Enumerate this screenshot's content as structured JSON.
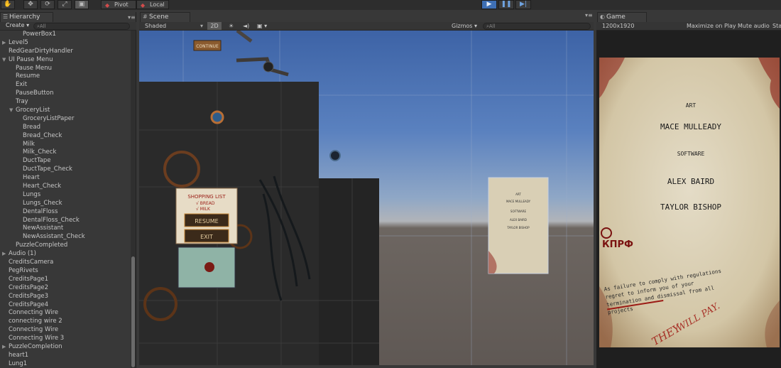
{
  "toolbar": {
    "tools": [
      "hand-tool",
      "move-tool",
      "rotate-tool",
      "scale-tool",
      "rect-tool"
    ],
    "pivot_label": "Pivot",
    "space_label": "Local"
  },
  "hierarchy": {
    "tab_label": "Hierarchy",
    "create_label": "Create",
    "search_placeholder": "All",
    "items": [
      {
        "label": "PowerBox1",
        "depth": 2,
        "arrow": ""
      },
      {
        "label": "Level5",
        "depth": 0,
        "arrow": "▶"
      },
      {
        "label": "RedGearDirtyHandler",
        "depth": 0,
        "arrow": ""
      },
      {
        "label": "UI Pause Menu",
        "depth": 0,
        "arrow": "▼"
      },
      {
        "label": "Pause Menu",
        "depth": 1,
        "arrow": ""
      },
      {
        "label": "Resume",
        "depth": 1,
        "arrow": ""
      },
      {
        "label": "Exit",
        "depth": 1,
        "arrow": ""
      },
      {
        "label": "PauseButton",
        "depth": 1,
        "arrow": ""
      },
      {
        "label": "Tray",
        "depth": 1,
        "arrow": ""
      },
      {
        "label": "GroceryList",
        "depth": 1,
        "arrow": "▼"
      },
      {
        "label": "GroceryListPaper",
        "depth": 2,
        "arrow": ""
      },
      {
        "label": "Bread",
        "depth": 2,
        "arrow": ""
      },
      {
        "label": "Bread_Check",
        "depth": 2,
        "arrow": ""
      },
      {
        "label": "Milk",
        "depth": 2,
        "arrow": ""
      },
      {
        "label": "Milk_Check",
        "depth": 2,
        "arrow": ""
      },
      {
        "label": "DuctTape",
        "depth": 2,
        "arrow": ""
      },
      {
        "label": "DuctTape_Check",
        "depth": 2,
        "arrow": ""
      },
      {
        "label": "Heart",
        "depth": 2,
        "arrow": ""
      },
      {
        "label": "Heart_Check",
        "depth": 2,
        "arrow": ""
      },
      {
        "label": "Lungs",
        "depth": 2,
        "arrow": ""
      },
      {
        "label": "Lungs_Check",
        "depth": 2,
        "arrow": ""
      },
      {
        "label": "DentalFloss",
        "depth": 2,
        "arrow": ""
      },
      {
        "label": "DentalFloss_Check",
        "depth": 2,
        "arrow": ""
      },
      {
        "label": "NewAssistant",
        "depth": 2,
        "arrow": ""
      },
      {
        "label": "NewAssistant_Check",
        "depth": 2,
        "arrow": ""
      },
      {
        "label": "PuzzleCompleted",
        "depth": 1,
        "arrow": ""
      },
      {
        "label": "Audio (1)",
        "depth": 0,
        "arrow": "▶"
      },
      {
        "label": "CreditsCamera",
        "depth": 0,
        "arrow": ""
      },
      {
        "label": "PegRivets",
        "depth": 0,
        "arrow": ""
      },
      {
        "label": "CreditsPage1",
        "depth": 0,
        "arrow": ""
      },
      {
        "label": "CreditsPage2",
        "depth": 0,
        "arrow": ""
      },
      {
        "label": "CreditsPage3",
        "depth": 0,
        "arrow": ""
      },
      {
        "label": "CreditsPage4",
        "depth": 0,
        "arrow": ""
      },
      {
        "label": "Connecting Wire",
        "depth": 0,
        "arrow": ""
      },
      {
        "label": "connecting wire 2",
        "depth": 0,
        "arrow": ""
      },
      {
        "label": "Connecting Wire",
        "depth": 0,
        "arrow": ""
      },
      {
        "label": "Connecting Wire 3",
        "depth": 0,
        "arrow": ""
      },
      {
        "label": "PuzzleCompletion",
        "depth": 0,
        "arrow": "▶"
      },
      {
        "label": "heart1",
        "depth": 0,
        "arrow": ""
      },
      {
        "label": "Lung1",
        "depth": 0,
        "arrow": ""
      }
    ]
  },
  "scene": {
    "tab_label": "Scene",
    "shading_mode": "Shaded",
    "mode_2d": "2D",
    "gizmos_label": "Gizmos",
    "search_placeholder": "All",
    "continue_sign": "CONTINUE",
    "shopping_title": "SHOPPING LIST",
    "shopping_line1": "√ BREAD",
    "shopping_line2": "√ MILK",
    "resume_label": "RESUME",
    "exit_label": "EXIT",
    "mini_credits": [
      "ART",
      "MACE MULLEADY",
      "SOFTWARE",
      "ALEX BAIRD",
      "TAYLOR BISHOP"
    ]
  },
  "game": {
    "tab_label": "Game",
    "resolution": "1200x1920",
    "maximize_label": "Maximize on Play",
    "mute_label": "Mute audio",
    "stats_label": "Sta",
    "credit_art_heading": "ART",
    "credit_art_name": "MACE MULLEADY",
    "credit_software_heading": "SOFTWARE",
    "credit_software_name1": "ALEX BAIRD",
    "credit_software_name2": "TAYLOR BISHOP",
    "stamp_text": "КПРФ",
    "warning_text_1": "As failure to comply with regulations",
    "warning_text_2": "regret to inform you of your",
    "warning_text_3": "termination and dismissal from all",
    "warning_text_4": "projects",
    "scrawl_text_1": "THEY",
    "scrawl_text_2": "WILL PAY."
  },
  "colors": {
    "play_active": "#3e6fb4",
    "panel_bg": "#383838",
    "paper": "#ddd4bc",
    "stain_red": "#8b1a14"
  }
}
